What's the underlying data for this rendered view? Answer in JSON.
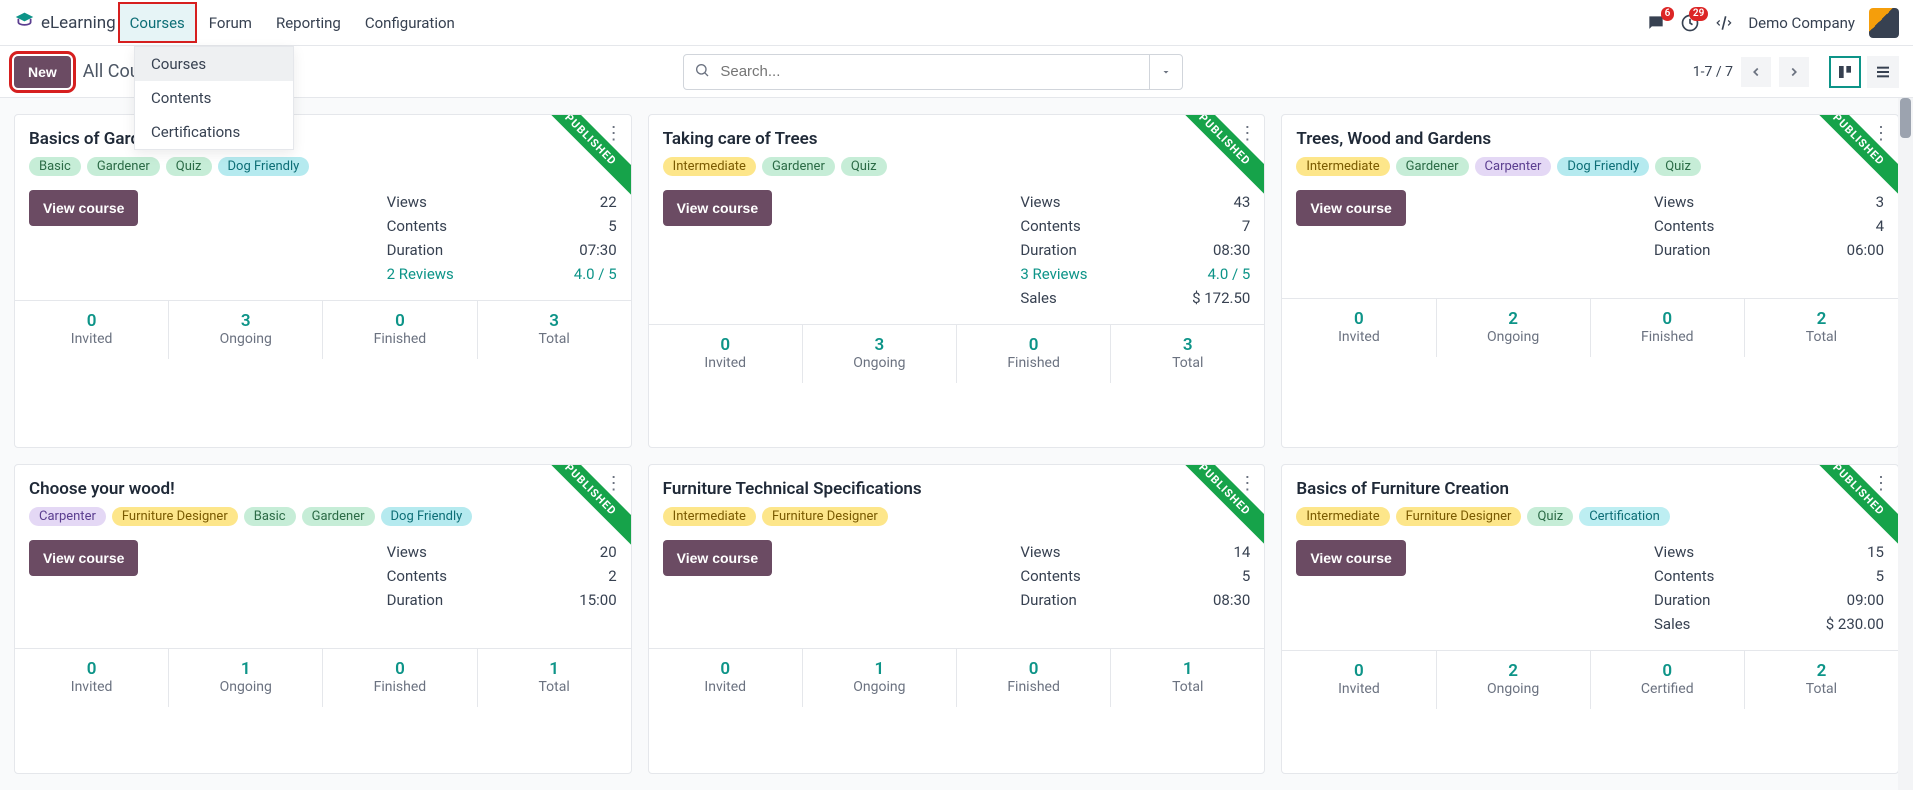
{
  "brand": "eLearning",
  "nav": [
    "Courses",
    "Forum",
    "Reporting",
    "Configuration"
  ],
  "nav_active_index": 0,
  "dropdown": {
    "items": [
      "Courses",
      "Contents",
      "Certifications"
    ],
    "hover_index": 0
  },
  "topbar": {
    "messages_badge": 6,
    "activities_badge": 29,
    "company": "Demo Company"
  },
  "controlbar": {
    "new_label": "New",
    "breadcrumb": "All Courses",
    "pager": "1-7 / 7"
  },
  "search": {
    "placeholder": "Search..."
  },
  "ribbon_text": "PUBLISHED",
  "view_course_label": "View course",
  "tag_colors": {
    "Basic": "green",
    "Gardener": "green",
    "Quiz": "green",
    "Dog Friendly": "teal",
    "Intermediate": "yellow",
    "Carpenter": "purple",
    "Furniture Designer": "yellow",
    "Certification": "cyan"
  },
  "courses": [
    {
      "title": "Basics of Gardening",
      "tags": [
        "Basic",
        "Gardener",
        "Quiz",
        "Dog Friendly"
      ],
      "stats": [
        {
          "k": "Views",
          "v": "22"
        },
        {
          "k": "Contents",
          "v": "5"
        },
        {
          "k": "Duration",
          "v": "07:30"
        },
        {
          "k": "2 Reviews",
          "v": "4.0 / 5",
          "link": true
        }
      ],
      "footer": [
        {
          "n": 0,
          "l": "Invited"
        },
        {
          "n": 3,
          "l": "Ongoing"
        },
        {
          "n": 0,
          "l": "Finished"
        },
        {
          "n": 3,
          "l": "Total"
        }
      ]
    },
    {
      "title": "Taking care of Trees",
      "tags": [
        "Intermediate",
        "Gardener",
        "Quiz"
      ],
      "stats": [
        {
          "k": "Views",
          "v": "43"
        },
        {
          "k": "Contents",
          "v": "7"
        },
        {
          "k": "Duration",
          "v": "08:30"
        },
        {
          "k": "3 Reviews",
          "v": "4.0 / 5",
          "link": true
        },
        {
          "k": "Sales",
          "v": "$ 172.50"
        }
      ],
      "footer": [
        {
          "n": 0,
          "l": "Invited"
        },
        {
          "n": 3,
          "l": "Ongoing"
        },
        {
          "n": 0,
          "l": "Finished"
        },
        {
          "n": 3,
          "l": "Total"
        }
      ]
    },
    {
      "title": "Trees, Wood and Gardens",
      "tags": [
        "Intermediate",
        "Gardener",
        "Carpenter",
        "Dog Friendly",
        "Quiz"
      ],
      "stats": [
        {
          "k": "Views",
          "v": "3"
        },
        {
          "k": "Contents",
          "v": "4"
        },
        {
          "k": "Duration",
          "v": "06:00"
        }
      ],
      "footer": [
        {
          "n": 0,
          "l": "Invited"
        },
        {
          "n": 2,
          "l": "Ongoing"
        },
        {
          "n": 0,
          "l": "Finished"
        },
        {
          "n": 2,
          "l": "Total"
        }
      ]
    },
    {
      "title": "Choose your wood!",
      "tags": [
        "Carpenter",
        "Furniture Designer",
        "Basic",
        "Gardener",
        "Dog Friendly"
      ],
      "stats": [
        {
          "k": "Views",
          "v": "20"
        },
        {
          "k": "Contents",
          "v": "2"
        },
        {
          "k": "Duration",
          "v": "15:00"
        }
      ],
      "footer": [
        {
          "n": 0,
          "l": "Invited"
        },
        {
          "n": 1,
          "l": "Ongoing"
        },
        {
          "n": 0,
          "l": "Finished"
        },
        {
          "n": 1,
          "l": "Total"
        }
      ]
    },
    {
      "title": "Furniture Technical Specifications",
      "tags": [
        "Intermediate",
        "Furniture Designer"
      ],
      "stats": [
        {
          "k": "Views",
          "v": "14"
        },
        {
          "k": "Contents",
          "v": "5"
        },
        {
          "k": "Duration",
          "v": "08:30"
        }
      ],
      "footer": [
        {
          "n": 0,
          "l": "Invited"
        },
        {
          "n": 1,
          "l": "Ongoing"
        },
        {
          "n": 0,
          "l": "Finished"
        },
        {
          "n": 1,
          "l": "Total"
        }
      ]
    },
    {
      "title": "Basics of Furniture Creation",
      "tags": [
        "Intermediate",
        "Furniture Designer",
        "Quiz",
        "Certification"
      ],
      "stats": [
        {
          "k": "Views",
          "v": "15"
        },
        {
          "k": "Contents",
          "v": "5"
        },
        {
          "k": "Duration",
          "v": "09:00"
        },
        {
          "k": "Sales",
          "v": "$ 230.00"
        }
      ],
      "footer": [
        {
          "n": 0,
          "l": "Invited"
        },
        {
          "n": 2,
          "l": "Ongoing"
        },
        {
          "n": 0,
          "l": "Certified"
        },
        {
          "n": 2,
          "l": "Total"
        }
      ]
    }
  ]
}
